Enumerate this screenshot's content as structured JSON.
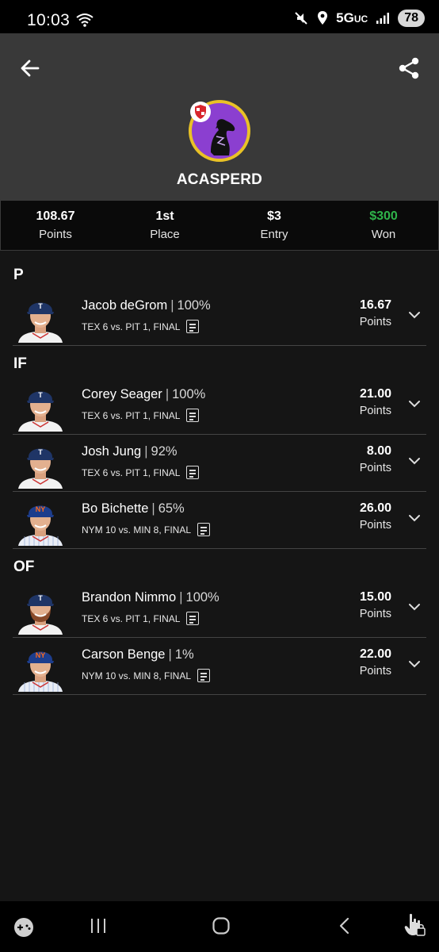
{
  "status": {
    "time": "10:03",
    "network": "5G",
    "network_sub": "UC",
    "battery": "78"
  },
  "header": {
    "username": "ACASPERD"
  },
  "stats": [
    {
      "value": "108.67",
      "label": "Points"
    },
    {
      "value": "1st",
      "label": "Place"
    },
    {
      "value": "$3",
      "label": "Entry"
    },
    {
      "value": "$300",
      "label": "Won"
    }
  ],
  "groups": [
    {
      "position": "P",
      "players": [
        {
          "name": "Jacob deGrom",
          "pct": "100%",
          "game": "TEX 6 vs. PIT 1, FINAL",
          "points": "16.67",
          "points_label": "Points",
          "team": "TEX"
        }
      ]
    },
    {
      "position": "IF",
      "players": [
        {
          "name": "Corey Seager",
          "pct": "100%",
          "game": "TEX 6 vs. PIT 1, FINAL",
          "points": "21.00",
          "points_label": "Points",
          "team": "TEX"
        },
        {
          "name": "Josh Jung",
          "pct": "92%",
          "game": "TEX 6 vs. PIT 1, FINAL",
          "points": "8.00",
          "points_label": "Points",
          "team": "TEX"
        },
        {
          "name": "Bo Bichette",
          "pct": "65%",
          "game": "NYM 10 vs. MIN 8, FINAL",
          "points": "26.00",
          "points_label": "Points",
          "team": "NYM"
        }
      ]
    },
    {
      "position": "OF",
      "players": [
        {
          "name": "Brandon Nimmo",
          "pct": "100%",
          "game": "TEX 6 vs. PIT 1, FINAL",
          "points": "15.00",
          "points_label": "Points",
          "team": "TEX"
        },
        {
          "name": "Carson Benge",
          "pct": "1%",
          "game": "NYM 10 vs. MIN 8, FINAL",
          "points": "22.00",
          "points_label": "Points",
          "team": "NYM"
        }
      ]
    }
  ],
  "colors": {
    "won": "#2fb34a",
    "avatar_bg": "#8b3fd0",
    "avatar_ring": "#e9c226",
    "header_bg": "#393939"
  },
  "icons": {
    "back": "arrow-left-icon",
    "share": "share-icon",
    "expand": "chevron-down-icon",
    "box_score": "document-icon"
  }
}
